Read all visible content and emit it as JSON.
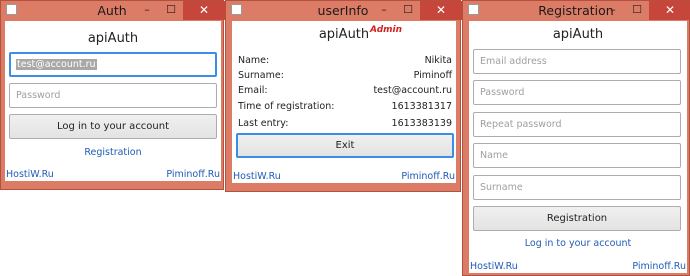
{
  "auth": {
    "title": "Auth",
    "heading": "apiAuth",
    "email_value": "test@account.ru",
    "password_placeholder": "Password",
    "login_label": "Log in to your account",
    "registration_link": "Registration",
    "footer_left": "HostiW.Ru",
    "footer_right": "Piminoff.Ru"
  },
  "userinfo": {
    "title": "userInfo",
    "heading": "apiAuth",
    "badge": "Admin",
    "rows": [
      {
        "label": "Name:",
        "value": "Nikita"
      },
      {
        "label": "Surname:",
        "value": "Piminoff"
      },
      {
        "label": "Email:",
        "value": "test@account.ru"
      },
      {
        "label": "Time of registration:",
        "value": "1613381317"
      },
      {
        "label": "Last entry:",
        "value": "1613383139"
      }
    ],
    "exit_label": "Exit",
    "footer_left": "HostiW.Ru",
    "footer_right": "Piminoff.Ru"
  },
  "registration": {
    "title": "Registration",
    "heading": "apiAuth",
    "email_placeholder": "Email address",
    "password_placeholder": "Password",
    "repeat_password_placeholder": "Repeat password",
    "name_placeholder": "Name",
    "surname_placeholder": "Surname",
    "register_label": "Registration",
    "login_link": "Log in to your account",
    "footer_left": "HostiW.Ru",
    "footer_right": "Piminoff.Ru"
  },
  "window_controls": {
    "minimize": "–",
    "maximize": "☐",
    "close": "✕"
  },
  "colors": {
    "frame": "#dd7c66",
    "close": "#c7463b",
    "focus": "#3a8ee6",
    "link": "#1f5cb8",
    "badge": "#d01f1f"
  }
}
